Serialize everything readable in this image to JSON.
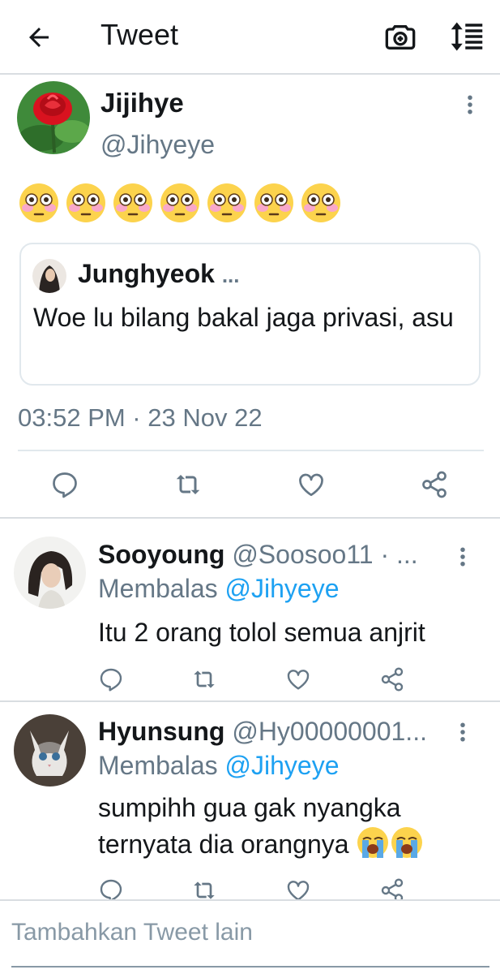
{
  "appbar": {
    "title": "Tweet",
    "icons": [
      "back-arrow-icon",
      "camera-add-icon",
      "sort-icon"
    ]
  },
  "main_tweet": {
    "name": "Jijihye",
    "handle": "@Jihyeye",
    "emoji_count": 7,
    "emoji": "flushed-face",
    "quote": {
      "name": "Junghyeok",
      "ellipsis": "...",
      "text": "Woe lu bilang bakal jaga privasi, asu"
    },
    "timestamp": "03:52 PM · 23 Nov 22",
    "actions": [
      "reply-icon",
      "retweet-icon",
      "like-icon",
      "share-icon"
    ]
  },
  "replies": [
    {
      "name": "Sooyoung",
      "handle": "@Soosoo11 · ...",
      "replying_prefix": "Membalas",
      "replying_to": "@Jihyeye",
      "text": "Itu 2 orang tolol semua anjrit"
    },
    {
      "name": "Hyunsung",
      "handle": "@Hy00000001...",
      "replying_prefix": "Membalas",
      "replying_to": "@Jihyeye",
      "text": "sumpihh gua gak nyangka ternyata dia orangnya",
      "trailing_emoji": "loudly-crying-face"
    }
  ],
  "compose": {
    "placeholder": "Tambahkan Tweet lain"
  },
  "colors": {
    "text": "#14171a",
    "secondary": "#657786",
    "link": "#1da1f2",
    "divider": "#d9dde1"
  }
}
